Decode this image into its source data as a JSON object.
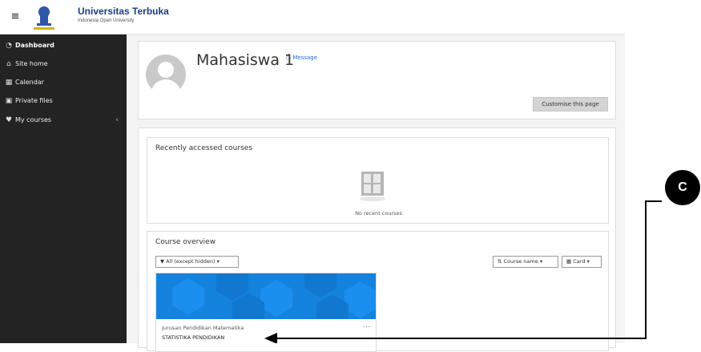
{
  "navbar": {
    "menu_icon": "hamburger-icon",
    "brand_title": "Universitas Terbuka",
    "brand_subtitle": "Indonesia Open University"
  },
  "sidebar": {
    "items": [
      {
        "label": "Dashboard",
        "icon": "dashboard-icon"
      },
      {
        "label": "Site home",
        "icon": "home-icon"
      },
      {
        "label": "Calendar",
        "icon": "calendar-icon"
      },
      {
        "label": "Private files",
        "icon": "file-icon"
      },
      {
        "label": "My courses",
        "icon": "graduation-cap-icon"
      }
    ],
    "active_index": 0
  },
  "profile": {
    "name": "Mahasiswa 1",
    "message_label": "Message",
    "customise_label": "Customise this page"
  },
  "recent": {
    "title": "Recently accessed courses",
    "empty_text": "No recent courses"
  },
  "overview": {
    "title": "Course overview",
    "filter_label": "All (except hidden)",
    "sort_label": "Course name",
    "view_label": "Card",
    "courses": [
      {
        "department": "Jurusan Pendidikan Matematika",
        "name": "STATISTIKA PENDIDIKAN"
      }
    ]
  },
  "annotation": {
    "label": "C"
  },
  "colors": {
    "sidebar_bg": "#232323",
    "course_image_bg": "#1582de",
    "brand_blue": "#1a3c8a",
    "link_blue": "#1a6fd6"
  }
}
